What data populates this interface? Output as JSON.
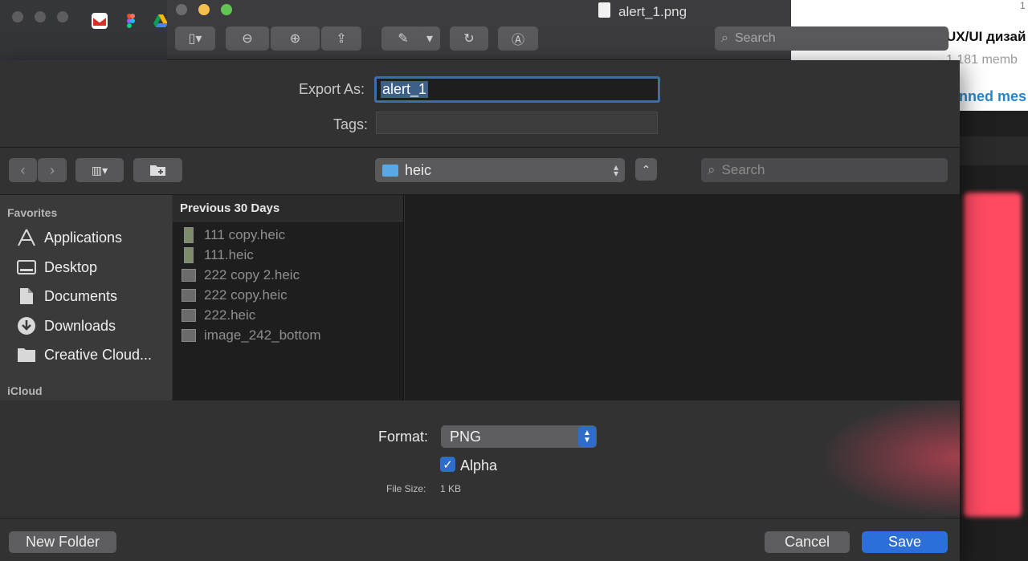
{
  "preview": {
    "title": "alert_1.png",
    "search_placeholder": "Search"
  },
  "background_page": {
    "title": "UX/UI дизай",
    "members": "1 181 memb",
    "pinned": "nned mes",
    "page_number": "1"
  },
  "export": {
    "export_as_label": "Export As:",
    "export_as_value": "alert_1",
    "tags_label": "Tags:"
  },
  "toolbar": {
    "location": "heic",
    "search_placeholder": "Search"
  },
  "sidebar": {
    "favorites_heading": "Favorites",
    "items": [
      {
        "label": "Applications",
        "icon": "applications-icon"
      },
      {
        "label": "Desktop",
        "icon": "desktop-icon"
      },
      {
        "label": "Documents",
        "icon": "documents-icon"
      },
      {
        "label": "Downloads",
        "icon": "downloads-icon"
      },
      {
        "label": "Creative Cloud...",
        "icon": "folder-icon"
      }
    ],
    "icloud_heading": "iCloud"
  },
  "files": {
    "heading": "Previous 30 Days",
    "items": [
      "111 copy.heic",
      "111.heic",
      "222 copy 2.heic",
      "222 copy.heic",
      "222.heic",
      "image_242_bottom"
    ]
  },
  "options": {
    "format_label": "Format:",
    "format_value": "PNG",
    "alpha_label": "Alpha",
    "alpha_checked": true,
    "file_size_label": "File Size:",
    "file_size_value": "1 KB"
  },
  "buttons": {
    "new_folder": "New Folder",
    "cancel": "Cancel",
    "save": "Save"
  },
  "colors": {
    "accent": "#2d6fd8",
    "focus_ring": "#3d6ea8"
  }
}
